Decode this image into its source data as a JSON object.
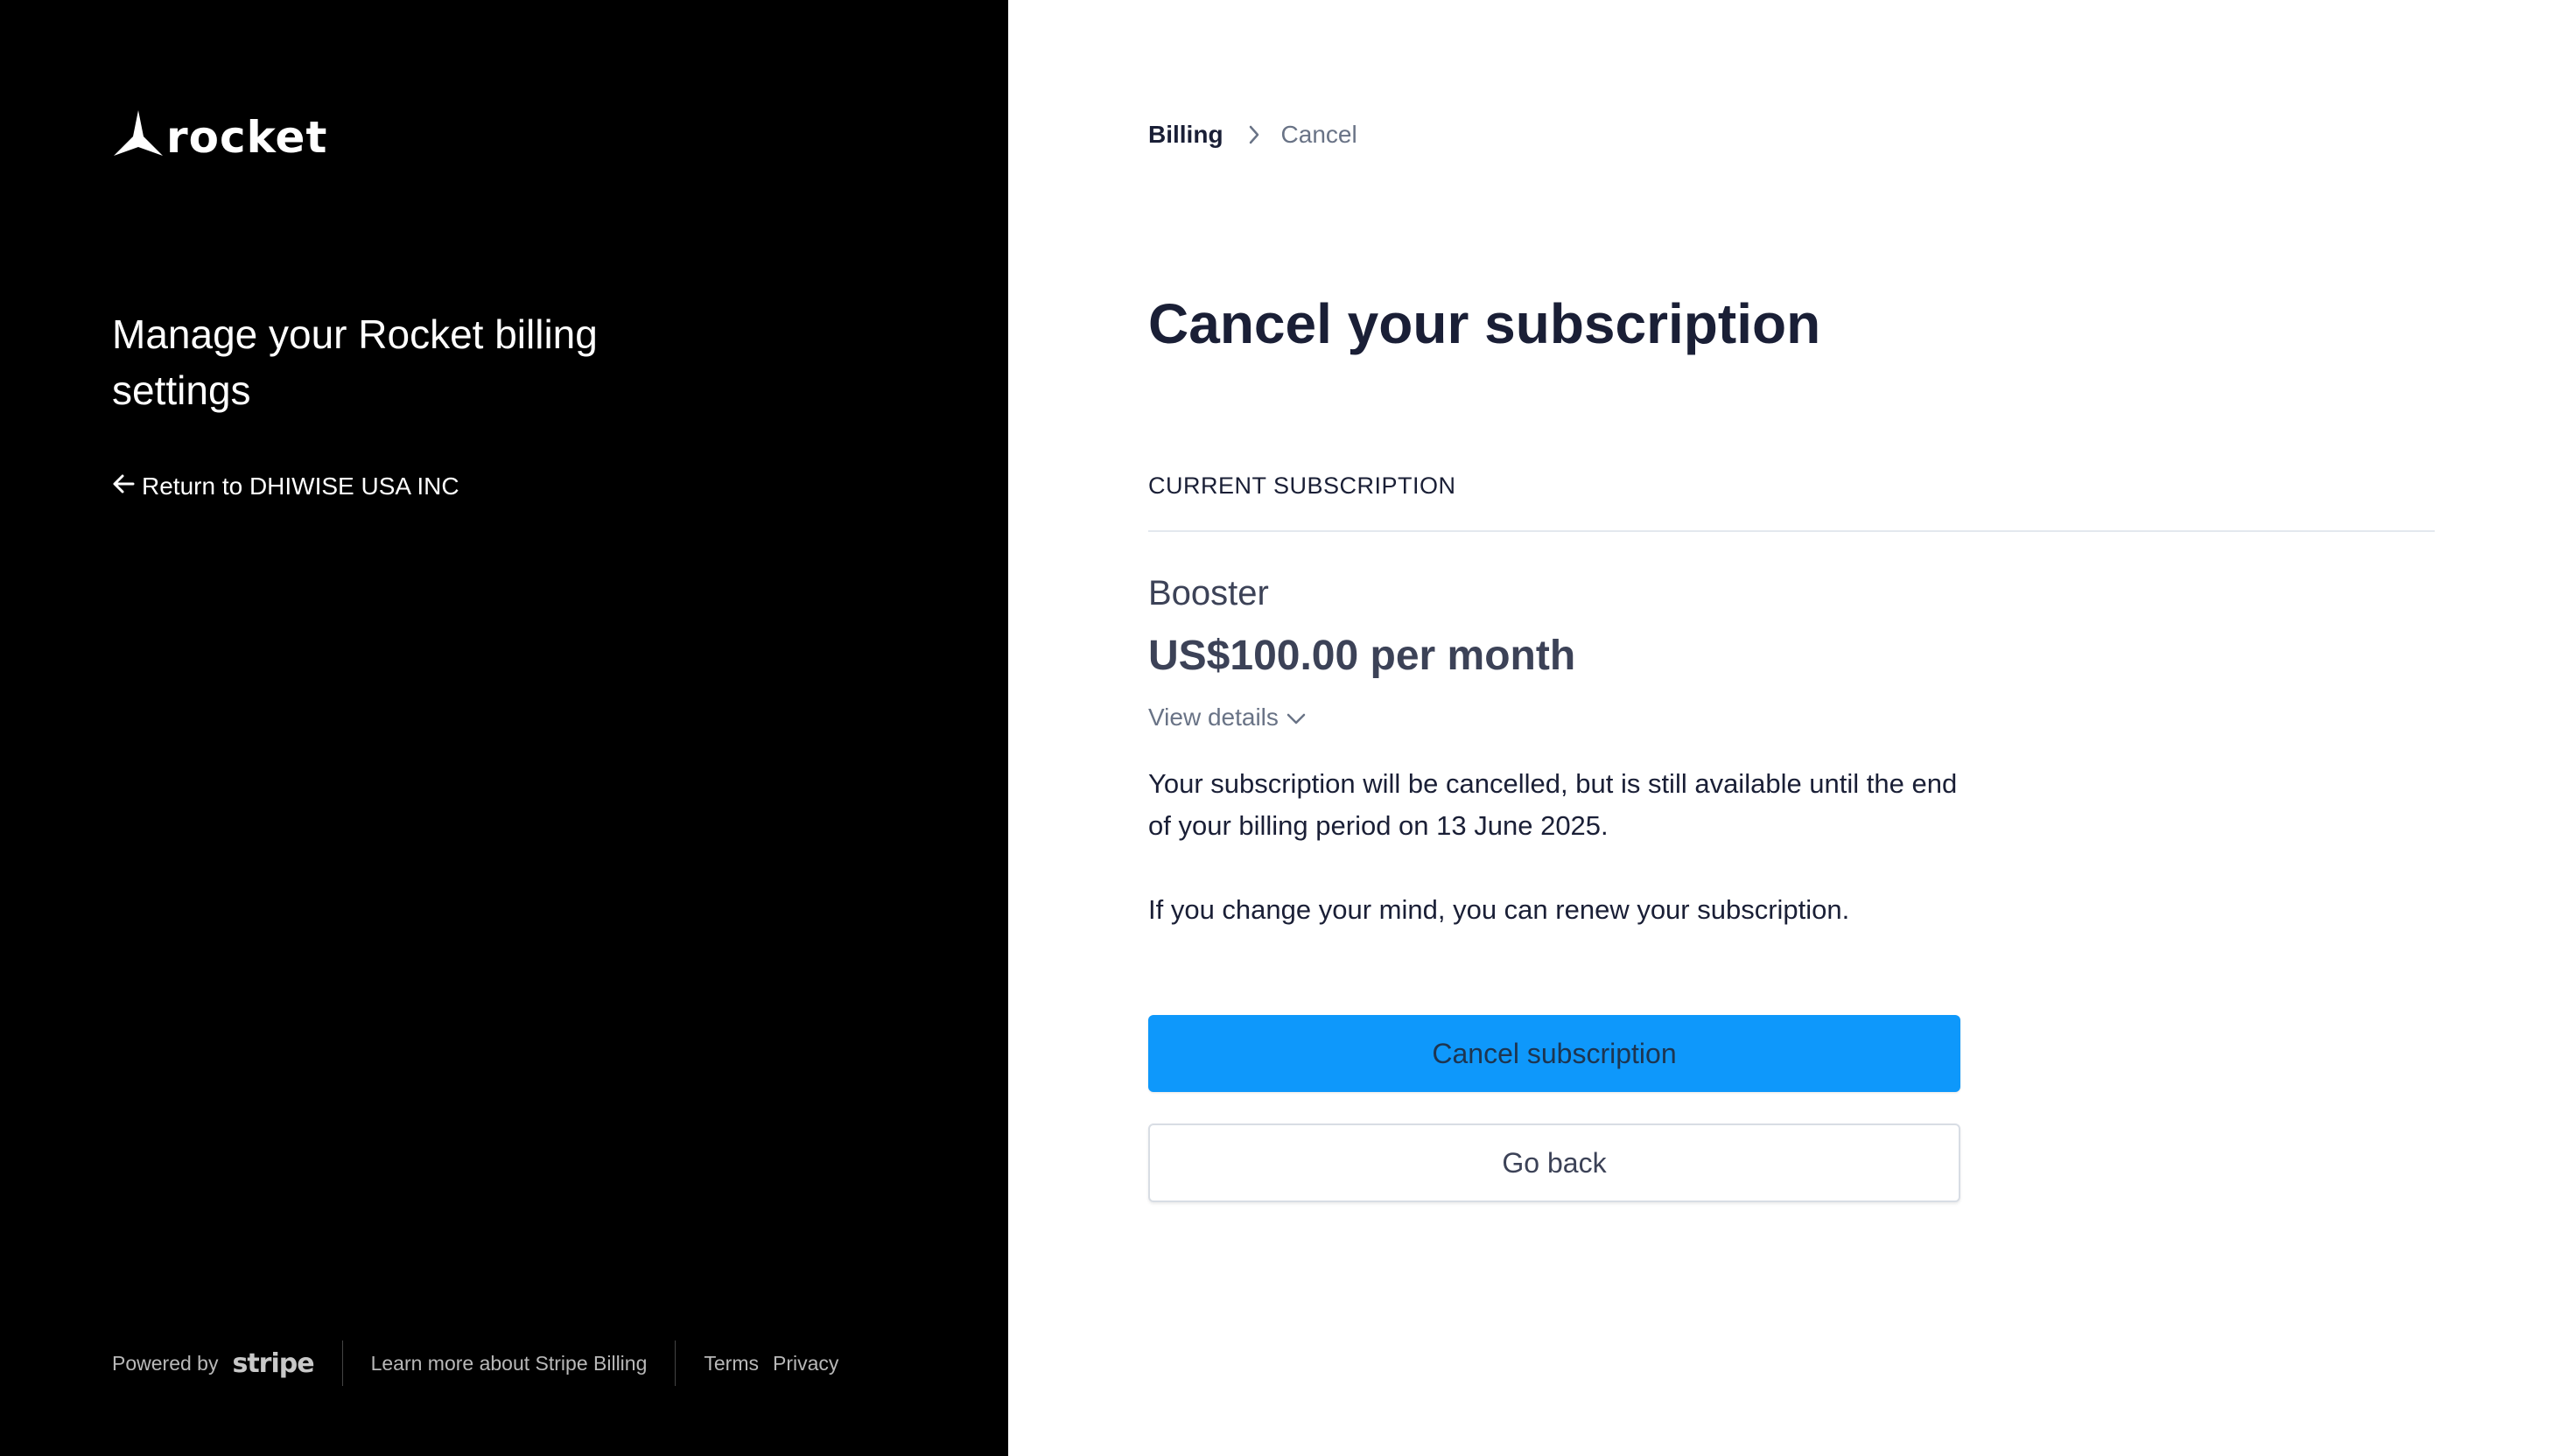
{
  "brand": {
    "logo_text": "rocket",
    "tagline": "Manage your Rocket billing settings",
    "return_link": "Return to DHIWISE USA INC"
  },
  "footer": {
    "powered_by": "Powered by",
    "stripe_word": "stripe",
    "learn_more": "Learn more about Stripe Billing",
    "terms": "Terms",
    "privacy": "Privacy"
  },
  "breadcrumb": {
    "parent": "Billing",
    "current": "Cancel"
  },
  "main": {
    "title": "Cancel your subscription",
    "section_label": "CURRENT SUBSCRIPTION",
    "plan_name": "Booster",
    "plan_price": "US$100.00 per month",
    "view_details": "View details",
    "notice": "Your subscription will be cancelled, but is still available until the end of your billing period on 13 June 2025.",
    "renew_note": "If you change your mind, you can renew your subscription.",
    "cancel_button": "Cancel subscription",
    "back_button": "Go back"
  },
  "colors": {
    "left_panel": "#000000",
    "primary_button": "#0e98fb",
    "heading": "#1a1f36",
    "muted": "#697386"
  },
  "icons": {
    "logo": "rocket-logo-icon",
    "return": "arrow-left-icon",
    "breadcrumb_separator": "chevron-right-icon",
    "view_details": "chevron-down-icon"
  }
}
